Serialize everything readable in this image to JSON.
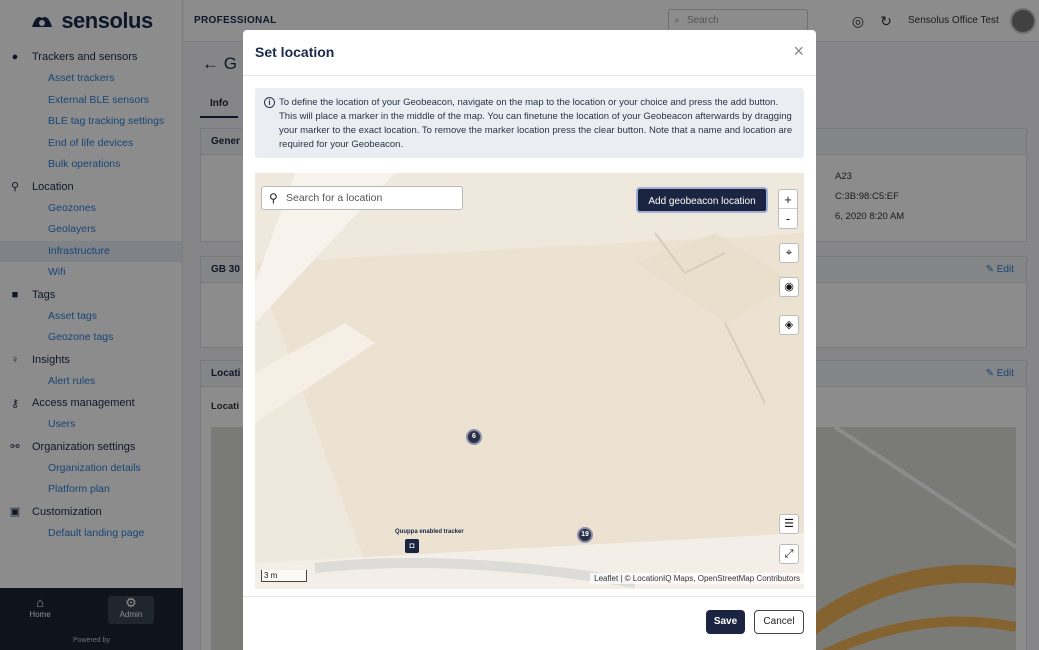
{
  "brand": {
    "name": "sensolus"
  },
  "sidebar": {
    "sections": [
      {
        "icon": "tracker-icon",
        "label": "Trackers and sensors",
        "items": [
          "Asset trackers",
          "External BLE sensors",
          "BLE tag tracking settings",
          "End of life devices",
          "Bulk operations"
        ]
      },
      {
        "icon": "location-pin-icon",
        "label": "Location",
        "items": [
          "Geozones",
          "Geolayers",
          "Infrastructure",
          "Wifi"
        ]
      },
      {
        "icon": "tag-icon",
        "label": "Tags",
        "items": [
          "Asset tags",
          "Geozone tags"
        ]
      },
      {
        "icon": "lightbulb-icon",
        "label": "Insights",
        "items": [
          "Alert rules"
        ]
      },
      {
        "icon": "key-icon",
        "label": "Access management",
        "items": [
          "Users"
        ]
      },
      {
        "icon": "org-chart-icon",
        "label": "Organization settings",
        "items": [
          "Organization details",
          "Platform plan"
        ]
      },
      {
        "icon": "customization-icon",
        "label": "Customization",
        "items": [
          "Default landing page"
        ]
      }
    ],
    "active_item": "Infrastructure",
    "footer": {
      "home_label": "Home",
      "admin_label": "Admin",
      "powered_by": "Powered by"
    }
  },
  "topbar": {
    "plan": "PROFESSIONAL",
    "search_placeholder": "Search",
    "org_name": "Sensolus Office Test"
  },
  "page": {
    "title_partial": "G",
    "tab": "Info",
    "cards": [
      {
        "title": "Gener",
        "values": [
          "A23",
          "C:3B:98:C5:EF",
          "6, 2020 8:20 AM"
        ]
      },
      {
        "title": "GB 30",
        "edit": "Edit"
      },
      {
        "title": "Locati",
        "edit": "Edit",
        "sub": "Locati"
      }
    ]
  },
  "modal": {
    "title": "Set location",
    "info": "To define the location of your Geobeacon, navigate on the map to the location or your choice and press the add button. This will place a marker in the middle of the map. You can finetune the location of your Geobeacon afterwards by dragging your marker to the exact location. To remove the marker location press the clear button. Note that a name and location are required for your Geobeacon.",
    "map": {
      "search_placeholder": "Search for a location",
      "add_button": "Add geobeacon location",
      "zoom_in": "+",
      "zoom_out": "-",
      "clusters": [
        "6",
        "19"
      ],
      "tracker_label": "Quuppa enabled tracker",
      "scale": "3 m",
      "attribution": "Leaflet | © LocationIQ Maps, OpenStreetMap Contributors"
    },
    "save_label": "Save",
    "cancel_label": "Cancel"
  }
}
